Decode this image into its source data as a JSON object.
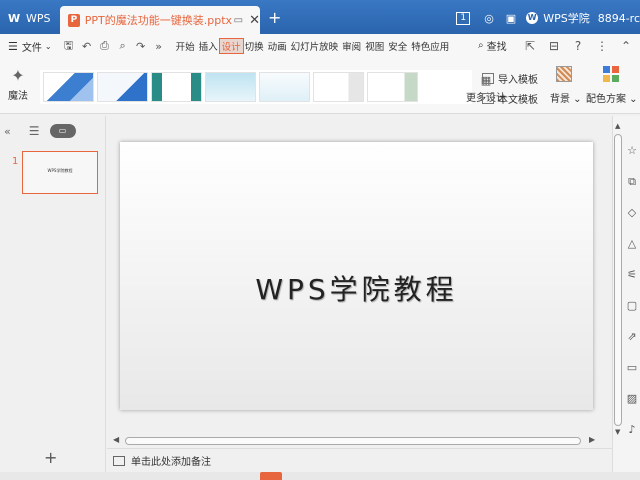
{
  "titlebar": {
    "app_tab": "WPS",
    "doc_icon": "P",
    "doc_title": "PPT的魔法功能一键换装.pptx",
    "badge": "1",
    "wpsx_logo": "W",
    "account": "WPS学院",
    "user": "8894-rc"
  },
  "menubar": {
    "file_label": "文件",
    "items": [
      "开始",
      "插入",
      "设计",
      "切换",
      "动画",
      "幻灯片放映",
      "审阅",
      "视图",
      "安全",
      "特色应用"
    ],
    "active_index": 2,
    "search_label": "查找"
  },
  "ribbon": {
    "magic_label": "魔法",
    "more_design_label": "更多设计",
    "import_template_label": "导入模板",
    "text_template_label": "本文模板",
    "background_label": "背景",
    "color_scheme_label": "配色方案"
  },
  "slides_panel": {
    "slide_number": "1",
    "thumb_text": "WPS学院教程"
  },
  "slide": {
    "title": "WPS学院教程"
  },
  "notes": {
    "placeholder": "单击此处添加备注"
  },
  "colors": {
    "accent": "#e8663d",
    "titlebar": "#2a64ad"
  }
}
